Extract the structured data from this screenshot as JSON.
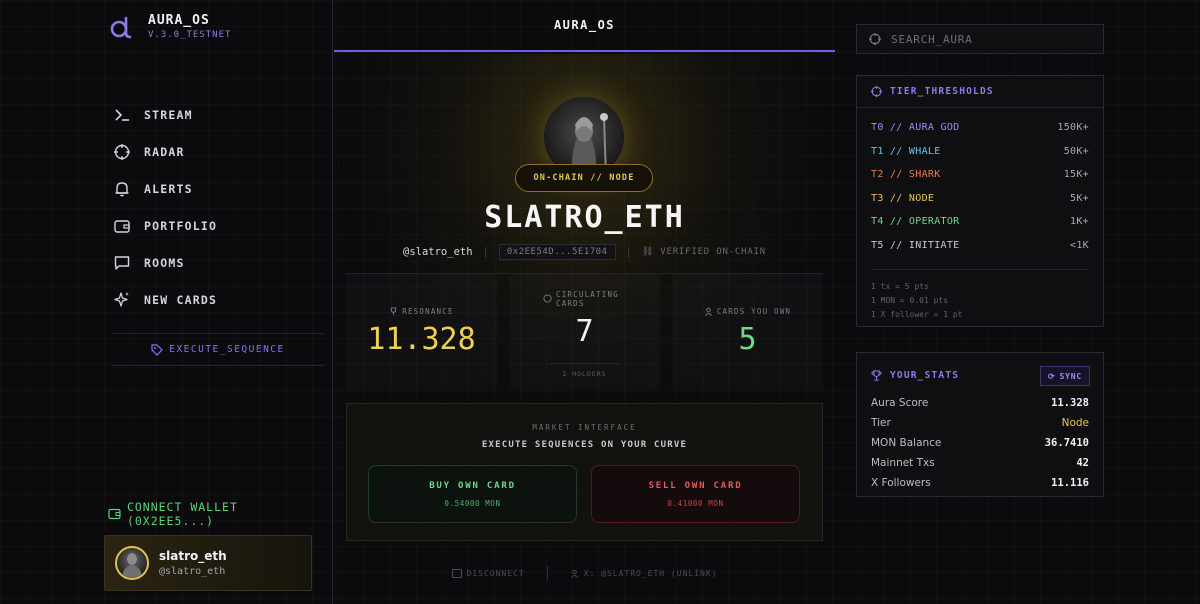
{
  "app": {
    "title": "AURA_OS",
    "version": "V.3.0_TESTNET"
  },
  "nav": [
    {
      "label": "STREAM",
      "icon": "terminal-icon"
    },
    {
      "label": "RADAR",
      "icon": "crosshair-icon"
    },
    {
      "label": "ALERTS",
      "icon": "bell-icon"
    },
    {
      "label": "PORTFOLIO",
      "icon": "wallet-icon"
    },
    {
      "label": "ROOMS",
      "icon": "chat-icon"
    },
    {
      "label": "NEW CARDS",
      "icon": "sparkle-icon"
    }
  ],
  "execute_label": "EXECUTE_SEQUENCE",
  "connect_label": "CONNECT WALLET (0X2EE5...)",
  "user": {
    "name": "slatro_eth",
    "handle": "@slatro_eth"
  },
  "header_title": "AURA_OS",
  "profile": {
    "tier_badge": "ON-CHAIN // NODE",
    "name": "SLATRO_ETH",
    "handle": "@slatro_eth",
    "address": "0x2EE54D...5E1704",
    "verified": "VERIFIED ON-CHAIN"
  },
  "stats": {
    "resonance_label": "RESONANCE",
    "resonance_value": "11.328",
    "circulating_label": "CIRCULATING CARDS",
    "circulating_value": "7",
    "holders": "2 HOLDERS",
    "owned_label": "CARDS YOU OWN",
    "owned_value": "5"
  },
  "market": {
    "title": "MARKET INTERFACE",
    "subtitle": "EXECUTE SEQUENCES ON YOUR CURVE",
    "buy_label": "BUY OWN CARD",
    "buy_price": "0.54000 MON",
    "sell_label": "SELL OWN CARD",
    "sell_price": "0.41000 MON"
  },
  "footer": {
    "disconnect": "DISCONNECT",
    "x_link": "X: @SLATRO_ETH (UNLINK)"
  },
  "search": {
    "placeholder": "SEARCH_AURA"
  },
  "tiers": {
    "title": "TIER_THRESHOLDS",
    "rows": [
      {
        "label": "T0 // AURA GOD",
        "value": "150K+",
        "color": "#9b8cf5"
      },
      {
        "label": "T1 // WHALE",
        "value": "50K+",
        "color": "#5fc8e8"
      },
      {
        "label": "T2 // SHARK",
        "value": "15K+",
        "color": "#f07a4a"
      },
      {
        "label": "T3 // NODE",
        "value": "5K+",
        "color": "#e8c84a"
      },
      {
        "label": "T4 // OPERATOR",
        "value": "1K+",
        "color": "#6fd88a"
      },
      {
        "label": "T5 // INITIATE",
        "value": "<1K",
        "color": "#c8c8d0"
      }
    ],
    "notes": [
      "1 tx = 5 pts",
      "1 MON = 0.01 pts",
      "1 X follower = 1 pt"
    ]
  },
  "your_stats": {
    "title": "YOUR_STATS",
    "sync_label": "SYNC",
    "rows": [
      {
        "key": "Aura Score",
        "value": "11.328"
      },
      {
        "key": "Tier",
        "value": "Node"
      },
      {
        "key": "MON Balance",
        "value": "36.7410"
      },
      {
        "key": "Mainnet Txs",
        "value": "42"
      },
      {
        "key": "X Followers",
        "value": "11.116"
      }
    ]
  },
  "colors": {
    "accent": "#8b7be8",
    "gold": "#e8c84a",
    "green": "#6fd88a",
    "red": "#e85a5a"
  }
}
